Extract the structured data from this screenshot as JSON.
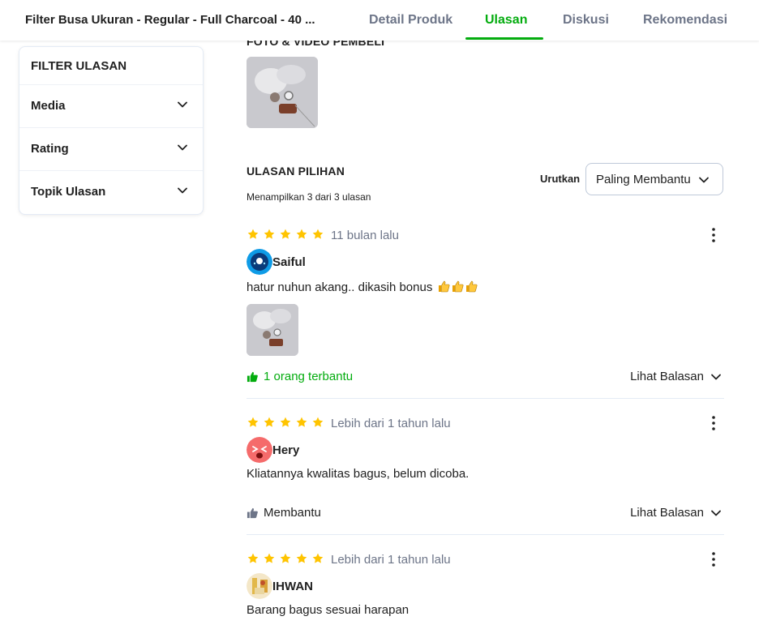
{
  "header": {
    "product_title": "Filter Busa Ukuran - Regular - Full Charcoal - 40 ...",
    "tabs": [
      {
        "label": "Detail Produk",
        "active": false
      },
      {
        "label": "Ulasan",
        "active": true
      },
      {
        "label": "Diskusi",
        "active": false
      },
      {
        "label": "Rekomendasi",
        "active": false
      }
    ]
  },
  "filter": {
    "title": "FILTER ULASAN",
    "items": [
      {
        "label": "Media"
      },
      {
        "label": "Rating"
      },
      {
        "label": "Topik Ulasan"
      }
    ]
  },
  "media_section": {
    "title": "FOTO & VIDEO PEMBELI"
  },
  "reviews_section": {
    "title": "ULASAN PILIHAN",
    "summary": "Menampilkan 3 dari 3 ulasan",
    "sort_label": "Urutkan",
    "sort_value": "Paling Membantu"
  },
  "reviews": [
    {
      "rating": 5,
      "time": "11 bulan lalu",
      "name": "Saiful",
      "text": "hatur nuhun akang.. dikasih bonus",
      "emoji_icons": [
        "thumbs-up-icon",
        "thumbs-up-icon",
        "thumbs-up-icon"
      ],
      "helpful": "1 orang terbantu",
      "see_reply": "Lihat Balasan"
    },
    {
      "rating": 5,
      "time": "Lebih dari 1 tahun lalu",
      "name": "Hery",
      "text": "Kliatannya kwalitas bagus, belum dicoba.",
      "helpful": "Membantu",
      "see_reply": "Lihat Balasan"
    },
    {
      "rating": 5,
      "time": "Lebih dari 1 tahun lalu",
      "name": "IHWAN",
      "text": "Barang bagus sesuai harapan"
    }
  ],
  "colors": {
    "accent": "#03ac0e",
    "star": "#ffc400",
    "muted_text": "#6d7588"
  }
}
